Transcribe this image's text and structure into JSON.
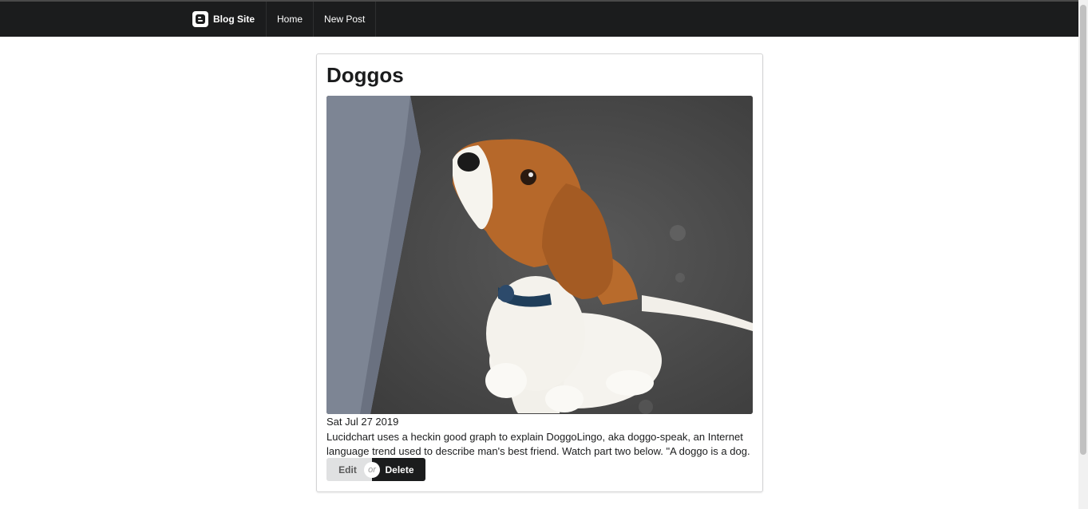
{
  "navbar": {
    "brand_label": "Blog Site",
    "brand_icon": "blogger-icon",
    "items": [
      {
        "label": "Home"
      },
      {
        "label": "New Post"
      }
    ]
  },
  "post": {
    "title": "Doggos",
    "image_alt": "beagle puppy photo",
    "date": "Sat Jul 27 2019",
    "body": "Lucidchart uses a heckin good graph to explain DoggoLingo, aka doggo-speak, an Internet language trend used to describe man's best friend. Watch part two below. \"A doggo is a dog.",
    "actions": {
      "edit_label": "Edit",
      "or_label": "or",
      "delete_label": "Delete"
    }
  },
  "colors": {
    "navbar_bg": "#1b1c1d",
    "delete_bg": "#1b1c1d",
    "edit_bg": "#e0e1e2"
  }
}
